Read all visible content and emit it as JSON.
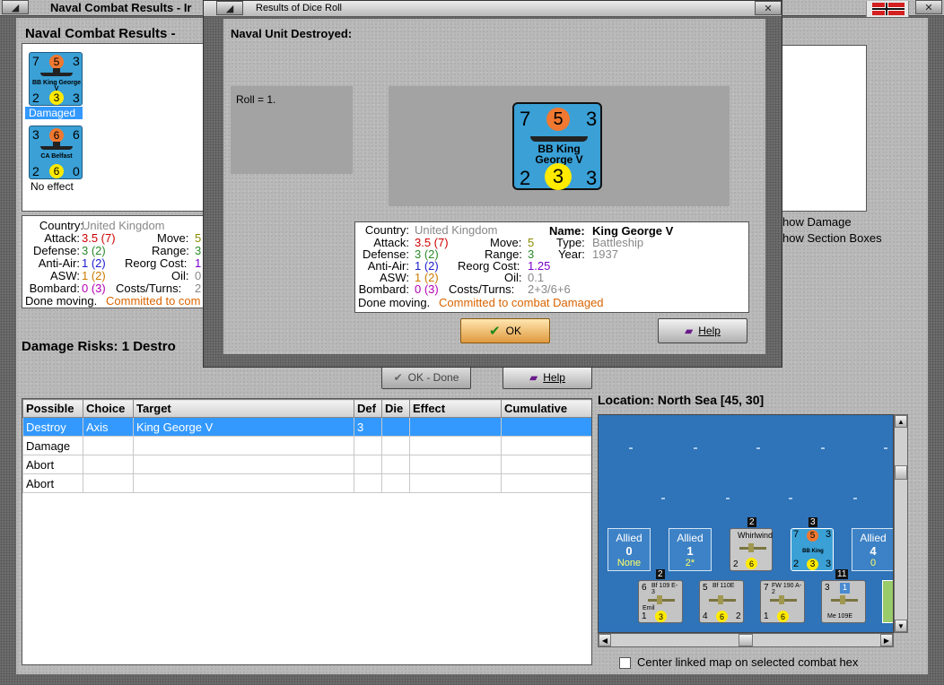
{
  "main_window": {
    "title": "Naval Combat Results - Ir",
    "heading": "Naval Combat Results -",
    "units": [
      {
        "attack": "7",
        "defense_circle": "5",
        "move": "3",
        "name": "BB King George V",
        "bottom_left": "2",
        "bottom_circle": "3",
        "bottom_right": "3",
        "status": "Damaged"
      },
      {
        "attack": "3",
        "defense_circle": "6",
        "move": "6",
        "name": "CA Belfast",
        "bottom_left": "2",
        "bottom_circle": "6",
        "bottom_right": "0",
        "status": "No effect"
      }
    ],
    "info": {
      "country_label": "Country:",
      "country_value": "United Kingdom",
      "attack_label": "Attack:",
      "attack_value": "3.5 (7)",
      "move_label": "Move:",
      "move_value": "5",
      "defense_label": "Defense:",
      "defense_value": "3 (2)",
      "range_label": "Range:",
      "range_value": "3",
      "antiair_label": "Anti-Air:",
      "antiair_value": "1 (2)",
      "reorg_label": "Reorg Cost:",
      "reorg_value": "1",
      "asw_label": "ASW:",
      "asw_value": "1 (2)",
      "oil_label": "Oil:",
      "oil_value": "0",
      "bombard_label": "Bombard:",
      "bombard_value": "0 (3)",
      "costs_label": "Costs/Turns:",
      "costs_value": "2",
      "status_prefix": "Done moving.",
      "status_value": "Committed to com"
    },
    "damage_risks": "Damage Risks:  1 Destro",
    "show_damage": "how Damage",
    "show_section_boxes": "how Section Boxes",
    "ok_done_label": "OK - Done",
    "help_label": "Help",
    "table": {
      "headers": [
        "Possible",
        "Choice",
        "Target",
        "Def",
        "Die",
        "Effect",
        "Cumulative"
      ],
      "rows": [
        [
          "Destroy",
          "Axis",
          "King George V",
          "3",
          "",
          "",
          ""
        ],
        [
          "Damage",
          "",
          "",
          "",
          "",
          "",
          ""
        ],
        [
          "Abort",
          "",
          "",
          "",
          "",
          "",
          ""
        ],
        [
          "Abort",
          "",
          "",
          "",
          "",
          "",
          ""
        ]
      ]
    },
    "location": "Location:  North Sea [45, 30]",
    "center_label": "Center linked map on selected combat hex",
    "map": {
      "boxes": [
        {
          "title": "Allied",
          "num": "0",
          "sub": "None"
        },
        {
          "title": "Allied",
          "num": "1",
          "sub": "2*"
        },
        {
          "title": "Allied",
          "num": "4",
          "sub": "0"
        }
      ],
      "air_top": [
        {
          "name": "Whirlwind",
          "left": "2",
          "circle": "6",
          "badge": "2"
        }
      ],
      "ship_top": {
        "a": "7",
        "circle": "5",
        "m": "3",
        "name": "BB King",
        "l": "2",
        "c": "3",
        "r": "3",
        "badge": "3"
      },
      "air_bottom": [
        {
          "top_left": "6",
          "name": "Bf 109 E-3",
          "sub": "Emil",
          "left": "1",
          "circle": "3",
          "badge": "2"
        },
        {
          "top_left": "5",
          "name": "Bf 110E",
          "sub": "",
          "left": "4",
          "circle": "6",
          "right": "2"
        },
        {
          "top_left": "7",
          "name": "FW 190 A-2",
          "sub": "",
          "left": "1",
          "circle": "6"
        },
        {
          "top_left": "3",
          "name": "Me 109E",
          "sub": "",
          "left": "",
          "circle": "1",
          "badge": "11"
        }
      ]
    }
  },
  "dialog": {
    "title": "Results of Dice Roll",
    "heading": "Naval Unit Destroyed:",
    "roll_text": "Roll = 1.",
    "counter": {
      "attack": "7",
      "defense_circle": "5",
      "move": "3",
      "name": "BB King George V",
      "bottom_left": "2",
      "bottom_circle": "3",
      "bottom_right": "3"
    },
    "info": {
      "country_label": "Country:",
      "country_value": "United Kingdom",
      "name_label": "Name:",
      "name_value": "King George V",
      "attack_label": "Attack:",
      "attack_value": "3.5 (7)",
      "move_label": "Move:",
      "move_value": "5",
      "type_label": "Type:",
      "type_value": "Battleship",
      "defense_label": "Defense:",
      "defense_value": "3 (2)",
      "range_label": "Range:",
      "range_value": "3",
      "year_label": "Year:",
      "year_value": "1937",
      "antiair_label": "Anti-Air:",
      "antiair_value": "1 (2)",
      "reorg_label": "Reorg Cost:",
      "reorg_value": "1.25",
      "asw_label": "ASW:",
      "asw_value": "1 (2)",
      "oil_label": "Oil:",
      "oil_value": "0.1",
      "bombard_label": "Bombard:",
      "bombard_value": "0 (3)",
      "costs_label": "Costs/Turns:",
      "costs_value": "2+3/6+6",
      "status_prefix": "Done moving.",
      "status_value": "Committed to combat Damaged"
    },
    "ok_label": "OK",
    "help_label": "Help"
  },
  "colors": {
    "unit_blue": "#3aa0d6",
    "defense_orange": "#f07830",
    "circle_yellow": "#ffea00",
    "selection_blue": "#3399ff",
    "sea_blue": "#2f73b8"
  }
}
